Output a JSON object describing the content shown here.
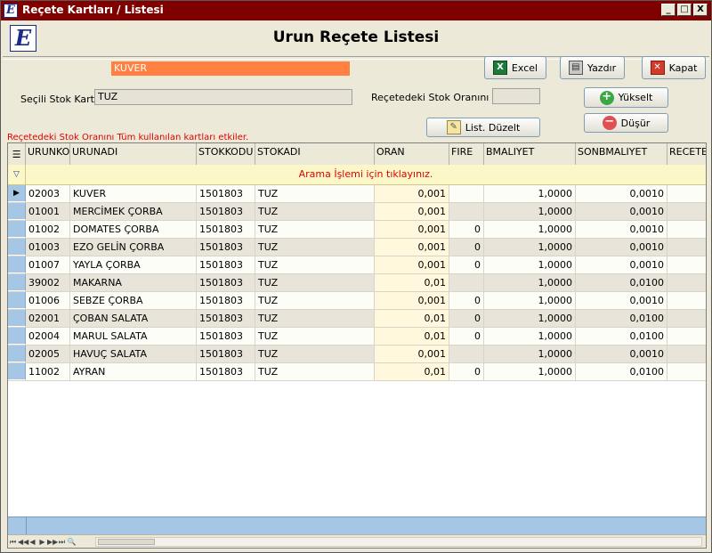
{
  "window": {
    "title": "Reçete Kartları / Listesi",
    "controls": [
      "_",
      "□",
      "X"
    ]
  },
  "header": {
    "logo_letter": "E",
    "title": "Urun Reçete Listesi"
  },
  "form": {
    "product_name": "KUVER",
    "selected_stock_label": "Seçili Stok Kartı :",
    "selected_stock_value": "TUZ",
    "ratio_label": "Reçetedeki Stok Oranını  :",
    "ratio_value": "",
    "note": "Reçetedeki Stok Oranını Tüm kullanılan kartları etkiler."
  },
  "buttons": {
    "excel": "Excel",
    "print": "Yazdır",
    "close": "Kapat",
    "raise": "Yükselt",
    "lower": "Düşür",
    "list_edit": "List. Düzelt"
  },
  "icons": {
    "excel": "excel-icon",
    "print": "printer-icon",
    "close": "close-icon",
    "raise": "plus-icon",
    "lower": "minus-icon",
    "list_edit": "edit-icon"
  },
  "grid": {
    "columns": [
      "URUNKO",
      "URUNADI",
      "STOKKODU",
      "STOKADI",
      "ORAN",
      "FIRE",
      "BMALIYET",
      "SONBMALIYET",
      "RECETE"
    ],
    "search_hint": "Arama İşlemi için tıklayınız.",
    "rows": [
      [
        "02003",
        "KUVER",
        "1501803",
        "TUZ",
        "0,001",
        "",
        "1,0000",
        "0,0010",
        ""
      ],
      [
        "01001",
        "MERCİMEK ÇORBA",
        "1501803",
        "TUZ",
        "0,001",
        "",
        "1,0000",
        "0,0010",
        ""
      ],
      [
        "01002",
        "DOMATES ÇORBA",
        "1501803",
        "TUZ",
        "0,001",
        "0",
        "1,0000",
        "0,0010",
        ""
      ],
      [
        "01003",
        "EZO GELİN ÇORBA",
        "1501803",
        "TUZ",
        "0,001",
        "0",
        "1,0000",
        "0,0010",
        ""
      ],
      [
        "01007",
        "YAYLA ÇORBA",
        "1501803",
        "TUZ",
        "0,001",
        "0",
        "1,0000",
        "0,0010",
        ""
      ],
      [
        "39002",
        "MAKARNA",
        "1501803",
        "TUZ",
        "0,01",
        "",
        "1,0000",
        "0,0100",
        ""
      ],
      [
        "01006",
        "SEBZE ÇORBA",
        "1501803",
        "TUZ",
        "0,001",
        "0",
        "1,0000",
        "0,0010",
        ""
      ],
      [
        "02001",
        "ÇOBAN SALATA",
        "1501803",
        "TUZ",
        "0,01",
        "0",
        "1,0000",
        "0,0100",
        ""
      ],
      [
        "02004",
        "MARUL SALATA",
        "1501803",
        "TUZ",
        "0,01",
        "0",
        "1,0000",
        "0,0100",
        ""
      ],
      [
        "02005",
        "HAVUÇ SALATA",
        "1501803",
        "TUZ",
        "0,001",
        "",
        "1,0000",
        "0,0010",
        ""
      ],
      [
        "11002",
        "AYRAN",
        "1501803",
        "TUZ",
        "0,01",
        "0",
        "1,0000",
        "0,0100",
        ""
      ]
    ],
    "selected_row_marker": "▶"
  },
  "navigator": [
    "⏮",
    "◀◀",
    "◀",
    "▶",
    "▶▶",
    "⏭",
    "🔍"
  ],
  "colors": {
    "titlebar": "#800000",
    "name_field": "#ff8040",
    "note_text": "#e00000",
    "oran_column": "#fff8dc"
  }
}
